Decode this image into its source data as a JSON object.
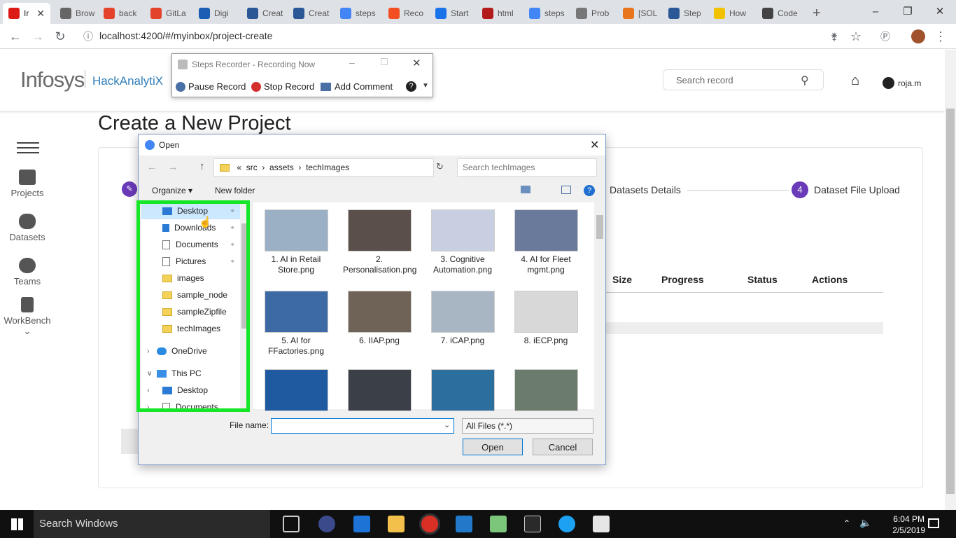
{
  "browser": {
    "tabs": [
      {
        "label": "Ir",
        "color": "#dd1b16"
      },
      {
        "label": "Brow",
        "color": "#666666"
      },
      {
        "label": "back",
        "color": "#e2432a"
      },
      {
        "label": "GitLa",
        "color": "#e2432a"
      },
      {
        "label": "Digi",
        "color": "#1a5fb4"
      },
      {
        "label": "Creat",
        "color": "#2b5797"
      },
      {
        "label": "Creat",
        "color": "#2b5797"
      },
      {
        "label": "steps",
        "color": "#4285f4"
      },
      {
        "label": "Reco",
        "color": "#f25022"
      },
      {
        "label": "Start",
        "color": "#1a73e8"
      },
      {
        "label": "html",
        "color": "#b31b1b"
      },
      {
        "label": "steps",
        "color": "#4285f4"
      },
      {
        "label": "Prob",
        "color": "#777777"
      },
      {
        "label": "[SOL",
        "color": "#e8741b"
      },
      {
        "label": "Step",
        "color": "#2b5797"
      },
      {
        "label": "How",
        "color": "#f2c200"
      },
      {
        "label": "Code",
        "color": "#444444"
      }
    ],
    "new_tab": "+",
    "url": "localhost:4200/#/myinbox/project-create"
  },
  "app": {
    "logo_main": "Infosys",
    "logo_sub": "HackAnalytiX",
    "search_placeholder": "Search record",
    "user": "roja.m",
    "page_title": "Create a New Project",
    "sidebar": [
      {
        "label": "Projects"
      },
      {
        "label": "Datasets"
      },
      {
        "label": "Teams"
      },
      {
        "label": "WorkBench"
      }
    ],
    "steps": {
      "step3_label": "Datasets Details",
      "step4_number": "4",
      "step4_label": "Dataset File Upload"
    },
    "table_headers": [
      "Size",
      "Progress",
      "Status",
      "Actions"
    ]
  },
  "recorder": {
    "title": "Steps Recorder - Recording Now",
    "pause": "Pause Record",
    "stop": "Stop Record",
    "comment": "Add Comment"
  },
  "dialog": {
    "title": "Open",
    "path": [
      "src",
      "assets",
      "techImages"
    ],
    "search_placeholder": "Search techImages",
    "organize": "Organize",
    "new_folder": "New folder",
    "nav_items": [
      {
        "label": "Desktop",
        "kind": "blue",
        "pinned": true
      },
      {
        "label": "Downloads",
        "kind": "download",
        "pinned": true
      },
      {
        "label": "Documents",
        "kind": "doc",
        "pinned": true
      },
      {
        "label": "Pictures",
        "kind": "doc",
        "pinned": true
      },
      {
        "label": "images",
        "kind": "folder",
        "pinned": false
      },
      {
        "label": "sample_node",
        "kind": "folder",
        "pinned": false
      },
      {
        "label": "sampleZipfile",
        "kind": "folder",
        "pinned": false
      },
      {
        "label": "techImages",
        "kind": "folder",
        "pinned": false
      },
      {
        "label": "OneDrive",
        "kind": "cloud",
        "pinned": false
      },
      {
        "label": "This PC",
        "kind": "pc",
        "pinned": false
      },
      {
        "label": "Desktop",
        "kind": "blue",
        "pinned": false
      },
      {
        "label": "Documents",
        "kind": "doc",
        "pinned": false
      }
    ],
    "files": [
      {
        "name": "1. AI in Retail Store.png",
        "color": "#9bb0c4"
      },
      {
        "name": "2. Personalisation.png",
        "color": "#5a4f4a"
      },
      {
        "name": "3. Cognitive Automation.png",
        "color": "#c8cfe0"
      },
      {
        "name": "4. AI for Fleet mgmt.png",
        "color": "#6a7a9a"
      },
      {
        "name": "5. AI for FFactories.png",
        "color": "#3d6aa5"
      },
      {
        "name": "6. IIAP.png",
        "color": "#6f6256"
      },
      {
        "name": "7. iCAP.png",
        "color": "#a8b6c4"
      },
      {
        "name": "8. iECP.png",
        "color": "#d8d8d8"
      },
      {
        "name": "",
        "color": "#1f5aa0"
      },
      {
        "name": "",
        "color": "#3a3f48"
      },
      {
        "name": "",
        "color": "#2c6e9e"
      },
      {
        "name": "",
        "color": "#6c7c6c"
      }
    ],
    "file_name_label": "File name:",
    "file_name_value": "",
    "file_type": "All Files (*.*)",
    "open_btn": "Open",
    "cancel_btn": "Cancel"
  },
  "taskbar": {
    "search": "Search Windows",
    "time": "6:04 PM",
    "date": "2/5/2019"
  }
}
